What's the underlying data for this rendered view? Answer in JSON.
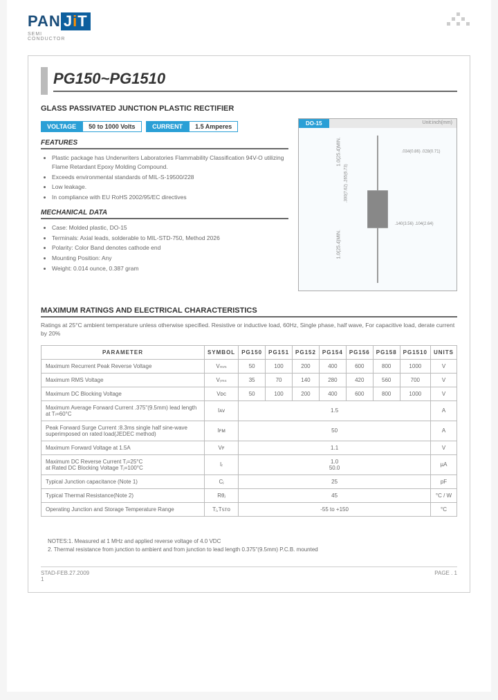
{
  "logo": {
    "brand": "PAN",
    "brand2": "J",
    "brand3": "T",
    "sub": "SEMI\nCONDUCTOR"
  },
  "part_title": "PG150~PG1510",
  "subtitle": "GLASS PASSIVATED JUNCTION PLASTIC RECTIFIER",
  "specs": {
    "voltage_label": "VOLTAGE",
    "voltage_val": "50 to 1000 Volts",
    "current_label": "CURRENT",
    "current_val": "1.5 Amperes"
  },
  "package": {
    "name": "DO-15",
    "unit": "Unit:inch(mm)",
    "dims": {
      "lead_min_top": "1.0(25.4)MIN.",
      "lead_min_bot": "1.0(25.4)MIN.",
      "body_l": ".300(7.62)\n.265(6.73)",
      "dia": ".034(0.86)\n.028(0.71)",
      "body_d": ".140(3.56)\n.104(2.64)"
    }
  },
  "features_hdr": "FEATURES",
  "features": [
    "Plastic package has Underwriters Laboratories Flammability Classification 94V-O utilizing Flame Retardant Epoxy Molding Compound.",
    "Exceeds environmental standards of MIL-S-19500/228",
    "Low leakage.",
    "In compliance with EU RoHS 2002/95/EC directives"
  ],
  "mech_hdr": "MECHANICAL DATA",
  "mech": [
    "Case: Molded plastic, DO-15",
    "Terminals: Axial leads, solderable to MIL-STD-750, Method 2026",
    "Polarity: Color Band denotes cathode end",
    "Mounting Position: Any",
    "Weight: 0.014 ounce, 0.387 gram"
  ],
  "max_hdr": "MAXIMUM RATINGS AND ELECTRICAL CHARACTERISTICS",
  "conditions": "Ratings at 25°C ambient temperature unless otherwise specified.  Resistive or inductive load, 60Hz, Single phase, half wave, For capacitive load, derate current by 20%",
  "table": {
    "headers": [
      "PARAMETER",
      "SYMBOL",
      "PG150",
      "PG151",
      "PG152",
      "PG154",
      "PG156",
      "PG158",
      "PG1510",
      "UNITS"
    ],
    "rows": [
      {
        "p": "Maximum Recurrent Peak Reverse Voltage",
        "s": "Vₘₘ",
        "v": [
          "50",
          "100",
          "200",
          "400",
          "600",
          "800",
          "1000"
        ],
        "u": "V"
      },
      {
        "p": "Maximum RMS Voltage",
        "s": "Vᵣₘₛ",
        "v": [
          "35",
          "70",
          "140",
          "280",
          "420",
          "560",
          "700"
        ],
        "u": "V"
      },
      {
        "p": "Maximum DC Blocking Voltage",
        "s": "Vᴅᴄ",
        "v": [
          "50",
          "100",
          "200",
          "400",
          "600",
          "800",
          "1000"
        ],
        "u": "V"
      }
    ],
    "spanrows": [
      {
        "p": "Maximum Average Forward  Current .375\"(9.5mm) lead length at Tₗ=60°C",
        "s": "Iᴀᴠ",
        "val": "1.5",
        "u": "A"
      },
      {
        "p": "Peak Forward Surge Current :8.3ms single half sine-wave superimposed on rated load(JEDEC method)",
        "s": "Iꜰᴍ",
        "val": "50",
        "u": "A"
      },
      {
        "p": "Maximum Forward Voltage at 1.5A",
        "s": "Vꜰ",
        "val": "1.1",
        "u": "V"
      },
      {
        "p": "Maximum DC Reverse Current  Tⱼ=25°C\nat Rated DC Blocking Voltage  Tⱼ=100°C",
        "s": "Iᵣ",
        "val": "1.0\n50.0",
        "u": "µA"
      },
      {
        "p": "Typical Junction capacitance (Note 1)",
        "s": "Cⱼ",
        "val": "25",
        "u": "pF"
      },
      {
        "p": "Typical Thermal Resistance(Note 2)",
        "s": "Rθⱼ",
        "val": "45",
        "u": "°C / W"
      },
      {
        "p": "Operating Junction and Storage Temperature Range",
        "s": "Tⱼ,Tꜱᴛᴏ",
        "val": "-55 to +150",
        "u": "°C"
      }
    ]
  },
  "notes": [
    "NOTES:1. Measured at 1 MHz and applied reverse voltage of 4.0 VDC",
    "2. Thermal resistance from junction to ambient and from junction to lead length 0.375\"(9.5mm) P.C.B. mounted"
  ],
  "footer": {
    "date": "STAD-FEB.27.2009",
    "page": "PAGE .  1",
    "small": "1"
  }
}
